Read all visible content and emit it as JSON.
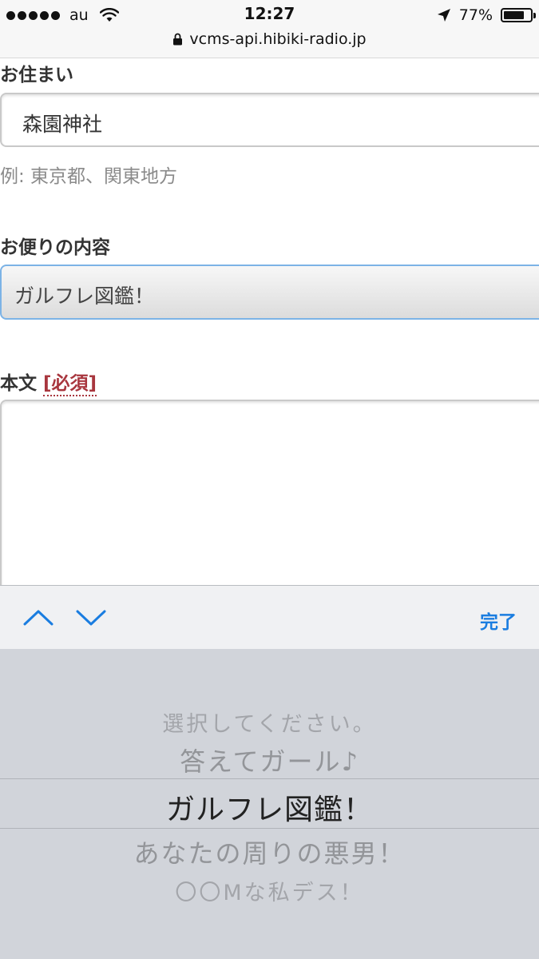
{
  "status": {
    "carrier": "au",
    "time": "12:27",
    "battery_pct": "77%",
    "battery_level": 0.77,
    "url": "vcms-api.hibiki-radio.jp"
  },
  "form": {
    "address_label": "お住まい",
    "address_value": "森園神社",
    "address_hint": "例: 東京都、関東地方",
    "content_label": "お便りの内容",
    "content_selected": "ガルフレ図鑑！",
    "body_label": "本文",
    "body_required": "[必須]"
  },
  "toolbar": {
    "done_label": "完了"
  },
  "picker": {
    "items": [
      "選択してください。",
      "答えてガール♪",
      "ガルフレ図鑑！",
      "あなたの周りの悪男！",
      "〇〇Mな私デス！"
    ],
    "selected_index": 2
  },
  "colors": {
    "accent": "#1a7de0",
    "required": "#a8363e"
  }
}
